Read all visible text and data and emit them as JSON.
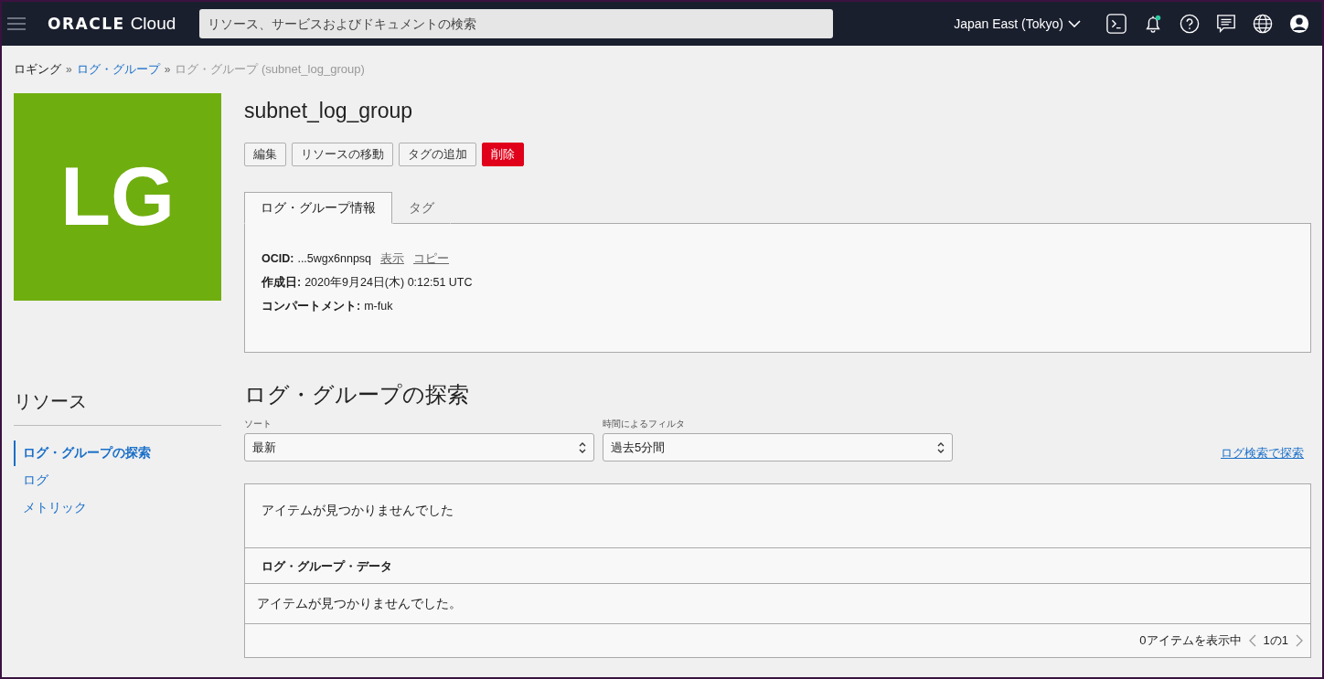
{
  "header": {
    "logo_brand": "ORACLE",
    "logo_product": "Cloud",
    "search": {
      "placeholder": "リソース、サービスおよびドキュメントの検索"
    },
    "region": "Japan East (Tokyo)",
    "has_notification": true
  },
  "breadcrumb": [
    {
      "label": "ロギング",
      "kind": "plain"
    },
    {
      "label": "ログ・グループ",
      "kind": "link"
    },
    {
      "label": "ログ・グループ (subnet_log_group)",
      "kind": "current"
    }
  ],
  "breadcrumb_separator": "»",
  "resource_tile": {
    "initials": "LG",
    "color": "#6fae0f"
  },
  "title": "subnet_log_group",
  "actions": [
    {
      "label": "編集",
      "kind": "default"
    },
    {
      "label": "リソースの移動",
      "kind": "default"
    },
    {
      "label": "タグの追加",
      "kind": "default"
    },
    {
      "label": "削除",
      "kind": "danger"
    }
  ],
  "tabs": [
    {
      "label": "ログ・グループ情報",
      "selected": true
    },
    {
      "label": "タグ",
      "selected": false
    }
  ],
  "info": {
    "ocid_label": "OCID:",
    "ocid_value": "...5wgx6nnpsq",
    "ocid_show": "表示",
    "ocid_copy": "コピー",
    "created_label": "作成日:",
    "created_value": "2020年9月24日(木) 0:12:51 UTC",
    "compartment_label": "コンパートメント:",
    "compartment_value": "m-fuk"
  },
  "sidebar": {
    "title": "リソース",
    "items": [
      {
        "label": "ログ・グループの探索",
        "selected": true
      },
      {
        "label": "ログ",
        "selected": false
      },
      {
        "label": "メトリック",
        "selected": false
      }
    ]
  },
  "explore": {
    "title": "ログ・グループの探索",
    "sort": {
      "label": "ソート",
      "value": "最新"
    },
    "time_filter": {
      "label": "時間によるフィルタ",
      "value": "過去5分間"
    },
    "search_link": "ログ検索で探索",
    "empty_message": "アイテムが見つかりませんでした",
    "table": {
      "columns": [
        "ログ・グループ・データ"
      ],
      "empty_message": "アイテムが見つかりませんでした。",
      "footer_count": "0アイテムを表示中",
      "page": "1の1"
    }
  }
}
